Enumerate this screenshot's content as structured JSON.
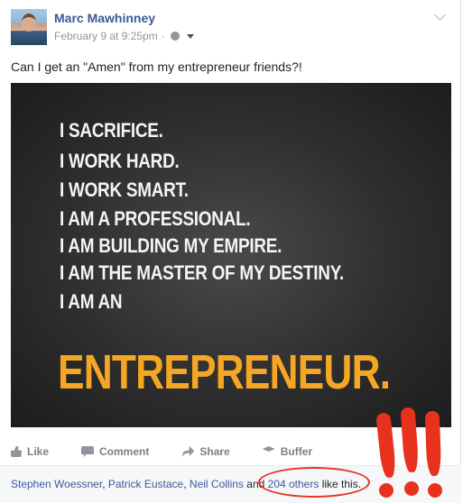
{
  "post": {
    "author": "Marc Mawhinney",
    "timestamp": "February 9 at 9:25pm",
    "separator": "·",
    "privacy_icon": "globe-icon",
    "text": "Can I get an \"Amen\" from my entrepreneur friends?!"
  },
  "image": {
    "lines": [
      "I SACRIFICE.",
      "I WORK HARD.",
      "I WORK SMART.",
      "I AM A PROFESSIONAL.",
      "I AM BUILDING MY EMPIRE.",
      "I AM THE MASTER OF MY DESTINY.",
      "I AM AN"
    ],
    "final_word": "ENTREPRENEUR.",
    "accent_color": "#f5a623"
  },
  "actions": {
    "like": "Like",
    "comment": "Comment",
    "share": "Share",
    "buffer": "Buffer"
  },
  "likes": {
    "people": [
      "Stephen Woessner",
      "Patrick Eustace",
      "Neil Collins"
    ],
    "comma": ", ",
    "and": " and ",
    "others": "204 others",
    "suffix": " like this."
  },
  "annotation": {
    "marks": "!!!",
    "color": "#e8321e"
  }
}
